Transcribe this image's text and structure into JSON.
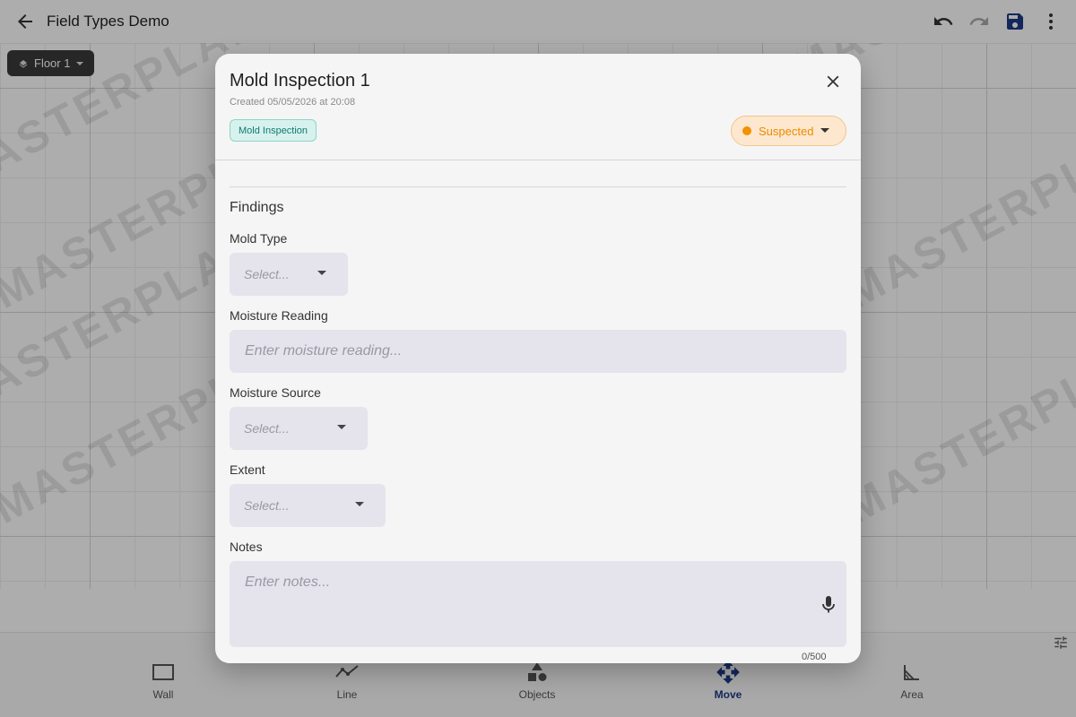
{
  "appbar": {
    "title": "Field Types Demo",
    "icons": [
      "back-arrow-icon",
      "undo-icon",
      "redo-icon",
      "save-icon",
      "more-vert-icon"
    ]
  },
  "canvas": {
    "watermark": "MASTERPLAN",
    "floor_label": "Floor 1"
  },
  "toolbar": {
    "items": [
      {
        "label": "Wall",
        "icon": "wall-icon"
      },
      {
        "label": "Line",
        "icon": "line-icon"
      },
      {
        "label": "Objects",
        "icon": "objects-icon"
      },
      {
        "label": "Move",
        "icon": "move-icon",
        "active": true
      },
      {
        "label": "Area",
        "icon": "area-icon"
      }
    ]
  },
  "dialog": {
    "title": "Mold Inspection 1",
    "subtitle": "Created 05/05/2026 at 20:08",
    "type_chip": "Mold Inspection",
    "status": "Suspected",
    "section_title": "Findings",
    "fields": {
      "mold_type": {
        "label": "Mold Type",
        "placeholder": "Select..."
      },
      "moisture_reading": {
        "label": "Moisture Reading",
        "placeholder": "Enter moisture reading..."
      },
      "moisture_source": {
        "label": "Moisture Source",
        "placeholder": "Select..."
      },
      "extent": {
        "label": "Extent",
        "placeholder": "Select..."
      },
      "notes": {
        "label": "Notes",
        "placeholder": "Enter notes...",
        "counter": "0/500"
      }
    }
  },
  "colors": {
    "accent": "#1e3a8a",
    "status_orange": "#ec8a00",
    "chip_teal": "#0f7a6c",
    "field_bg": "#e5e3ec"
  }
}
